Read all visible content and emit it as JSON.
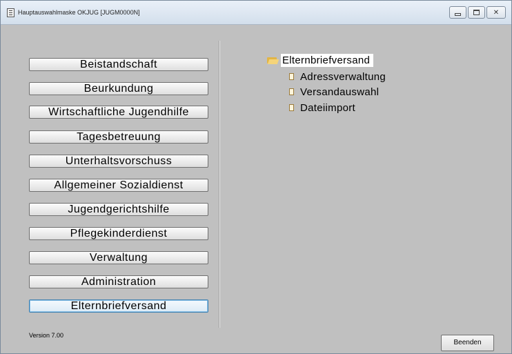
{
  "window": {
    "title": "Hauptauswahlmaske OKJUG [JUGM0000N]",
    "icon": "document-app-icon",
    "controls": [
      "minimize-icon",
      "maximize-icon",
      "close-icon"
    ],
    "close_glyph": "✕"
  },
  "modules": [
    {
      "label": "Beistandschaft"
    },
    {
      "label": "Beurkundung"
    },
    {
      "label": "Wirtschaftliche Jugendhilfe"
    },
    {
      "label": "Tagesbetreuung"
    },
    {
      "label": "Unterhaltsvorschuss"
    },
    {
      "label": "Allgemeiner Sozialdienst"
    },
    {
      "label": "Jugendgerichtshilfe"
    },
    {
      "label": "Pflegekinderdienst"
    },
    {
      "label": "Verwaltung"
    },
    {
      "label": "Administration"
    },
    {
      "label": "Elternbriefversand",
      "selected": true
    }
  ],
  "tree": {
    "root": {
      "label": "Elternbriefversand",
      "icon": "folder-open-icon"
    },
    "children": [
      {
        "label": "Adressverwaltung",
        "icon": "document-icon"
      },
      {
        "label": "Versandauswahl",
        "icon": "document-icon"
      },
      {
        "label": "Dateiimport",
        "icon": "document-icon"
      }
    ]
  },
  "footer": {
    "version": "Version 7.00",
    "exit_label": "Beenden"
  }
}
